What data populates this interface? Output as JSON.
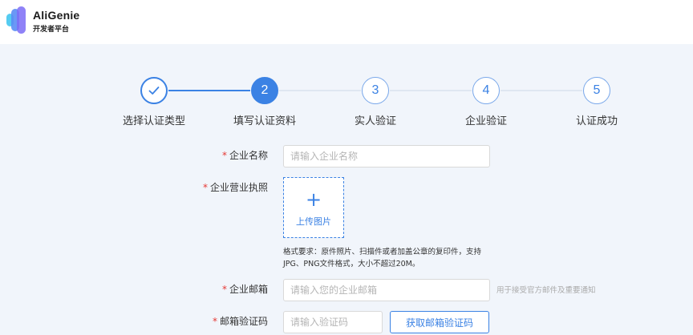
{
  "header": {
    "app_name": "AliGenie",
    "app_subtitle": "开发者平台",
    "logo_colors": [
      "#7b6cf6",
      "#5a8df5",
      "#42c6f0"
    ]
  },
  "steps": [
    {
      "number": "",
      "label": "选择认证类型",
      "state": "done",
      "icon": "check-icon"
    },
    {
      "number": "2",
      "label": "填写认证资料",
      "state": "active"
    },
    {
      "number": "3",
      "label": "实人验证",
      "state": "pending"
    },
    {
      "number": "4",
      "label": "企业验证",
      "state": "pending"
    },
    {
      "number": "5",
      "label": "认证成功",
      "state": "pending"
    }
  ],
  "form": {
    "required_mark": "*",
    "company_name": {
      "label": "企业名称",
      "placeholder": "请输入企业名称",
      "value": ""
    },
    "business_license": {
      "label": "企业营业执照",
      "upload_icon": "plus-icon",
      "upload_text": "上传图片",
      "hint_line1": "格式要求：原件照片、扫描件或者加盖公章的复印件，支持",
      "hint_line2": "JPG、PNG文件格式，大小不超过20M。"
    },
    "email": {
      "label": "企业邮箱",
      "placeholder": "请输入您的企业邮箱",
      "value": "",
      "hint": "用于接受官方邮件及重要通知"
    },
    "email_code": {
      "label": "邮箱验证码",
      "placeholder": "请输入验证码",
      "value": "",
      "button": "获取邮箱验证码"
    }
  },
  "colors": {
    "primary": "#3b82e4",
    "required": "#e53935",
    "background": "#f1f5fb"
  }
}
